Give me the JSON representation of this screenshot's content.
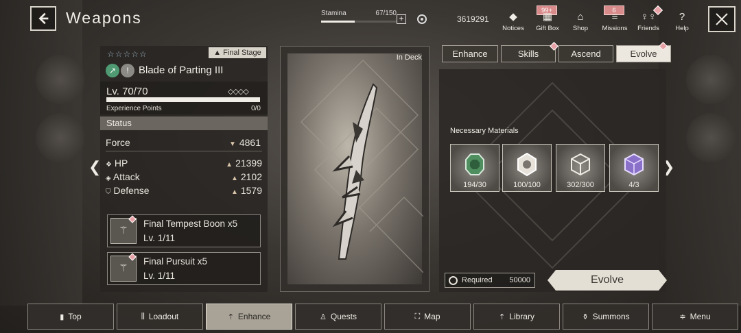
{
  "header": {
    "title": "Weapons",
    "stamina_label": "Stamina",
    "stamina_value": "67/150",
    "stamina_fraction": 0.447,
    "currency": "3619291",
    "nav": [
      {
        "label": "Notices",
        "icon": "notices-icon",
        "glyph": "◆"
      },
      {
        "label": "Gift Box",
        "icon": "gift-box-icon",
        "glyph": "▦",
        "badge": "99+"
      },
      {
        "label": "Shop",
        "icon": "shop-icon",
        "glyph": "⌂"
      },
      {
        "label": "Missions",
        "icon": "missions-icon",
        "glyph": "≡",
        "badge": "6"
      },
      {
        "label": "Friends",
        "icon": "friends-icon",
        "glyph": "♀♀"
      },
      {
        "label": "Help",
        "icon": "help-icon",
        "glyph": "?"
      }
    ]
  },
  "weapon": {
    "stars": "☆☆☆☆☆",
    "stage": "Final Stage",
    "name": "Blade of Parting III",
    "level": "Lv. 70/70",
    "level_diamonds": "◇◇◇◇",
    "xp_label": "Experience Points",
    "xp_value": "0/0",
    "status_label": "Status",
    "force_label": "Force",
    "force_value": "4861",
    "stats": [
      {
        "label": "HP",
        "value": "21399",
        "icon": "hp-icon"
      },
      {
        "label": "Attack",
        "value": "2102",
        "icon": "attack-icon"
      },
      {
        "label": "Defense",
        "value": "1579",
        "icon": "defense-icon"
      }
    ],
    "skills": [
      {
        "name": "Final Tempest Boon x5",
        "level": "Lv. 1/11"
      },
      {
        "name": "Final Pursuit x5",
        "level": "Lv. 1/11"
      }
    ],
    "in_deck": "In Deck"
  },
  "tabs": [
    "Enhance",
    "Skills",
    "Ascend",
    "Evolve"
  ],
  "active_tab": "Evolve",
  "materials": {
    "title": "Necessary Materials",
    "items": [
      {
        "count": "194/30",
        "color": "#4f8f5f"
      },
      {
        "count": "100/100",
        "color": "#cfcac0"
      },
      {
        "count": "302/300",
        "color": "#b8b3aa"
      },
      {
        "count": "4/3",
        "color": "#8a70c8"
      }
    ]
  },
  "required": {
    "label": "Required",
    "amount": "50000"
  },
  "evolve_button": "Evolve",
  "bottom_nav": [
    {
      "label": "Top",
      "glyph": "▮"
    },
    {
      "label": "Loadout",
      "glyph": "⫼"
    },
    {
      "label": "Enhance",
      "glyph": "⇡"
    },
    {
      "label": "Quests",
      "glyph": "♙"
    },
    {
      "label": "Map",
      "glyph": "⛶"
    },
    {
      "label": "Library",
      "glyph": "⇡"
    },
    {
      "label": "Summons",
      "glyph": "⚱"
    },
    {
      "label": "Menu",
      "glyph": "≑"
    }
  ]
}
